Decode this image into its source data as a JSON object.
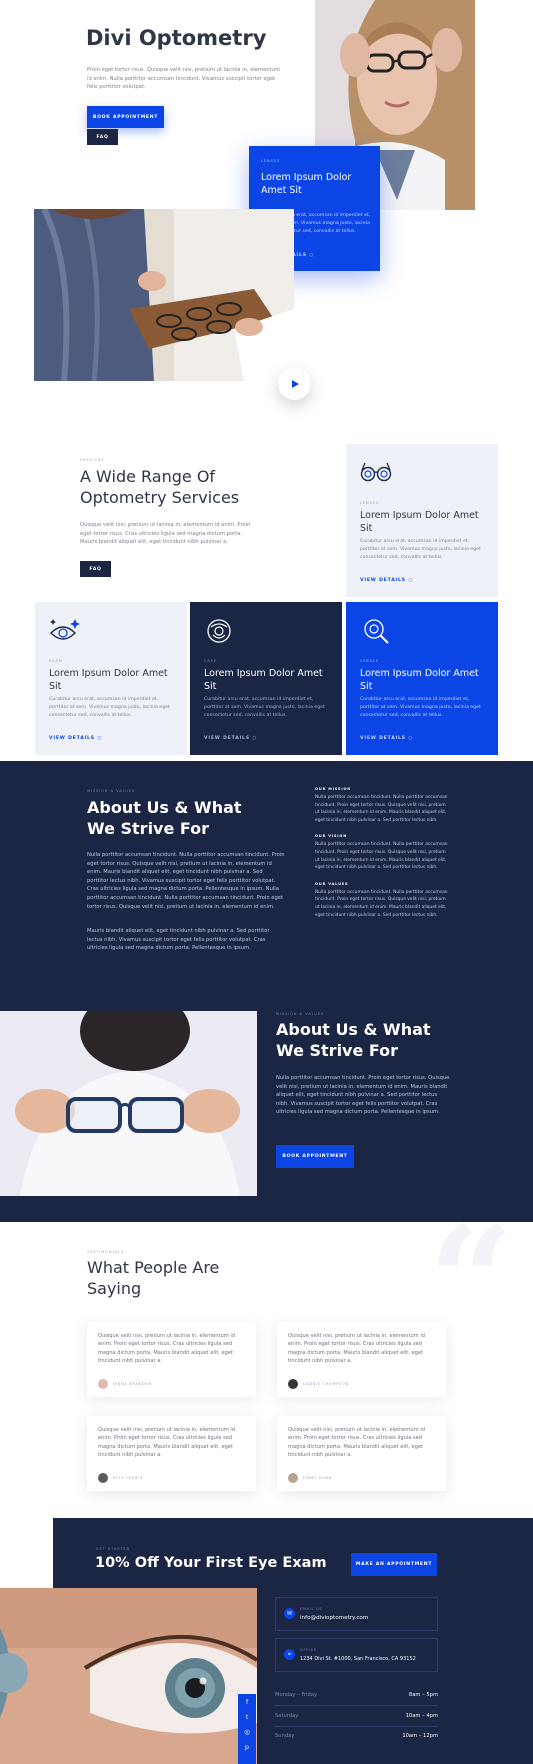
{
  "hero": {
    "title": "Divi Optometry",
    "text": "Proin eget tortor risus. Quisque velit nisi, pretium ut lacinia in, elementum id enim. Nulla porttitor accumsan tincidunt. Vivamus suscipit tortor eget felis porttitor volutpat.",
    "book_label": "BOOK APPOINTMENT",
    "faq_label": "FAQ",
    "card": {
      "eyebrow": "LENSES",
      "title": "Lorem Ipsum Dolor Amet Sit",
      "text": "Curabitur arcu erat, accumsan id imperdiet et, porttitor at sem. Vivamus magna justo, lacinia eget consectetur sed, convallis at tellus.",
      "link": "VIEW DETAILS"
    }
  },
  "services": {
    "eyebrow": "SERVICES",
    "title": "A Wide Range Of Optometry Services",
    "text": "Quisque velit nisi, pretium ut lacinia in, elementum id enim. Proin eget tortor risus. Cras ultricies ligula sed magna dictum porta. Mauris blandit aliquet elit, eget tincidunt nibh pulvinar a.",
    "faq_label": "FAQ",
    "cards": [
      {
        "eyebrow": "LENSES",
        "title": "Lorem Ipsum Dolor Amet Sit",
        "text": "Curabitur arcu erat, accumsan id imperdiet et, porttitor at sem. Vivamus magna justo, lacinia eget consectetur sed, convallis at tellus.",
        "link": "VIEW DETAILS",
        "icon": "glasses-icon"
      },
      {
        "eyebrow": "EXAM",
        "title": "Lorem Ipsum Dolor Amet Sit",
        "text": "Curabitur arcu erat, accumsan id imperdiet et, porttitor at sem. Vivamus magna justo, lacinia eget consectetur sed, convallis at tellus.",
        "link": "VIEW DETAILS",
        "icon": "eye-exam-icon"
      },
      {
        "eyebrow": "CARE",
        "title": "Lorem Ipsum Dolor Amet Sit",
        "text": "Curabitur arcu erat, accumsan id imperdiet et, porttitor at sem. Vivamus magna justo, lacinia eget consectetur sed, convallis at tellus.",
        "link": "VIEW DETAILS",
        "icon": "contact-lens-icon"
      },
      {
        "eyebrow": "LENSES",
        "title": "Lorem Ipsum Dolor Amet Sit",
        "text": "Curabitur arcu erat, accumsan id imperdiet et, porttitor at sem. Vivamus magna justo, lacinia eget consectetur sed, convallis at tellus.",
        "link": "VIEW DETAILS",
        "icon": "magnifier-icon"
      }
    ]
  },
  "about": {
    "eyebrow": "MISSION & VALUES",
    "title": "About Us & What We Strive For",
    "text1": "Nulla porttitor accumsan tincidunt. Nulla porttitor accumsan tincidunt. Proin eget tortor risus. Quisque velit nisi, pretium ut lacinia in, elementum id enim. Mauris blandit aliquet elit, eget tincidunt nibh pulvinar a. Sed porttitor lectus nibh. Vivamus suscipit tortor eget felis porttitor volutpat. Cras ultricies ligula sed magna dictum porta. Pellentesque in ipsum. Nulla porttitor accumsan tincidunt. Nulla porttitor accumsan tincidunt. Proin eget tortor risus. Quisque velit nisi, pretium ut lacinia in, elementum id enim.",
    "text2": "Mauris blandit aliquet elit, eget tincidunt nibh pulvinar a. Sed porttitor lectus nibh. Vivamus suscipit tortor eget felis porttitor volutpat. Cras ultricies ligula sed magna dictum porta. Pellentesque in ipsum.",
    "blocks": [
      {
        "label": "OUR MISSION",
        "text": "Nulla porttitor accumsan tincidunt. Nulla porttitor accumsan tincidunt. Proin eget tortor risus. Quisque velit nisi, pretium ut lacinia in, elementum id enim. Mauris blandit aliquet elit, eget tincidunt nibh pulvinar a. Sed porttitor lectus nibh."
      },
      {
        "label": "OUR VISION",
        "text": "Nulla porttitor accumsan tincidunt. Nulla porttitor accumsan tincidunt. Proin eget tortor risus. Quisque velit nisi, pretium ut lacinia in, elementum id enim. Mauris blandit aliquet elit, eget tincidunt nibh pulvinar a. Sed porttitor lectus nibh."
      },
      {
        "label": "OUR VALUES",
        "text": "Nulla porttitor accumsan tincidunt. Nulla porttitor accumsan tincidunt. Proin eget tortor risus. Quisque velit nisi, pretium ut lacinia in, elementum id enim. Mauris blandit aliquet elit, eget tincidunt nibh pulvinar a. Sed porttitor lectus nibh."
      }
    ]
  },
  "about2": {
    "eyebrow": "MISSION & VALUES",
    "title": "About Us & What We Strive For",
    "text": "Nulla porttitor accumsan tincidunt. Proin eget tortor risus. Quisque velit nisi, pretium ut lacinia in, elementum id enim. Mauris blandit aliquet elit, eget tincidunt nibh pulvinar a. Sed porttitor lectus nibh. Vivamus suscipit tortor eget felis porttitor volutpat. Cras ultricies ligula sed magna dictum porta. Pellentesque in ipsum.",
    "button": "BOOK APPOINTMENT"
  },
  "testimonials": {
    "eyebrow": "TESTIMONIALS",
    "title": "What People Are Saying",
    "items": [
      {
        "text": "Quisque velit nisi, pretium ut lacinia in, elementum id enim. Proin eget tortor risus. Cras ultricies ligula sed magna dictum porta. Mauris blandit aliquet elit, eget tincidunt nibh pulvinar a.",
        "name": "JENNA BRANDEN"
      },
      {
        "text": "Quisque velit nisi, pretium ut lacinia in, elementum id enim. Proin eget tortor risus. Cras ultricies ligula sed magna dictum porta. Mauris blandit aliquet elit, eget tincidunt nibh pulvinar a.",
        "name": "DANNIE THOMPSON"
      },
      {
        "text": "Quisque velit nisi, pretium ut lacinia in, elementum id enim. Proin eget tortor risus. Cras ultricies ligula sed magna dictum porta. Mauris blandit aliquet elit, eget tincidunt nibh pulvinar a.",
        "name": "KYLE FERRIS"
      },
      {
        "text": "Quisque velit nisi, pretium ut lacinia in, elementum id enim. Proin eget tortor risus. Cras ultricies ligula sed magna dictum porta. Mauris blandit aliquet elit, eget tincidunt nibh pulvinar a.",
        "name": "JIMMY DUNN"
      }
    ]
  },
  "cta": {
    "eyebrow": "GET STARTED",
    "title": "10% Off Your First Eye Exam",
    "button": "MAKE AN APPOINTMENT",
    "email_label": "EMAIL US",
    "email": "info@divioptometry.com",
    "office_label": "OFFICE",
    "address": "1234 Divi St. #1000, San Francisco, CA 93152",
    "hours": [
      {
        "day": "Monday – Friday",
        "time": "8am – 5pm"
      },
      {
        "day": "Saturday",
        "time": "10am – 4pm"
      },
      {
        "day": "Sunday",
        "time": "10am – 12pm"
      }
    ],
    "social": [
      "facebook-icon",
      "twitter-icon",
      "instagram-icon",
      "pinterest-icon"
    ]
  },
  "colors": {
    "accent": "#0b45e6",
    "navy": "#1b2544",
    "light": "#eff1f8"
  }
}
